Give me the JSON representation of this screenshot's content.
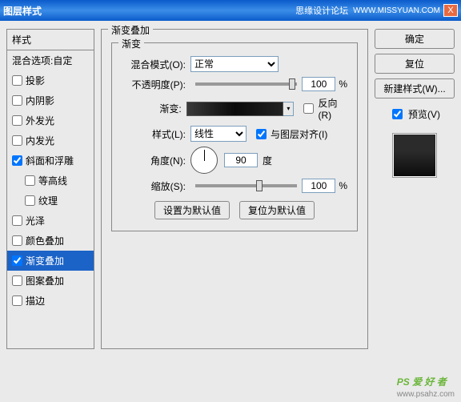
{
  "titlebar": {
    "title": "图层样式",
    "brand": "思缘设计论坛",
    "url": "WWW.MISSYUAN.COM",
    "close": "X"
  },
  "styles": {
    "header": "样式",
    "blend_options": "混合选项:自定",
    "items": [
      {
        "label": "投影",
        "checked": false
      },
      {
        "label": "内阴影",
        "checked": false
      },
      {
        "label": "外发光",
        "checked": false
      },
      {
        "label": "内发光",
        "checked": false
      },
      {
        "label": "斜面和浮雕",
        "checked": true
      },
      {
        "label": "等高线",
        "checked": false,
        "indent": true
      },
      {
        "label": "纹理",
        "checked": false,
        "indent": true
      },
      {
        "label": "光泽",
        "checked": false
      },
      {
        "label": "颜色叠加",
        "checked": false
      },
      {
        "label": "渐变叠加",
        "checked": true,
        "selected": true
      },
      {
        "label": "图案叠加",
        "checked": false
      },
      {
        "label": "描边",
        "checked": false
      }
    ]
  },
  "panel": {
    "title": "渐变叠加",
    "gradient_group": "渐变",
    "blend_mode_label": "混合模式(O):",
    "blend_mode_value": "正常",
    "opacity_label": "不透明度(P):",
    "opacity_value": "100",
    "percent": "%",
    "gradient_label": "渐变:",
    "reverse_label": "反向(R)",
    "style_label": "样式(L):",
    "style_value": "线性",
    "align_label": "与图层对齐(I)",
    "angle_label": "角度(N):",
    "angle_value": "90",
    "degree": "度",
    "scale_label": "缩放(S):",
    "scale_value": "100",
    "set_default": "设置为默认值",
    "reset_default": "复位为默认值"
  },
  "right": {
    "ok": "确定",
    "cancel": "复位",
    "new_style": "新建样式(W)...",
    "preview": "预览(V)"
  },
  "watermark": {
    "logo": "PS 爱 好 者",
    "url": "www.psahz.com"
  }
}
